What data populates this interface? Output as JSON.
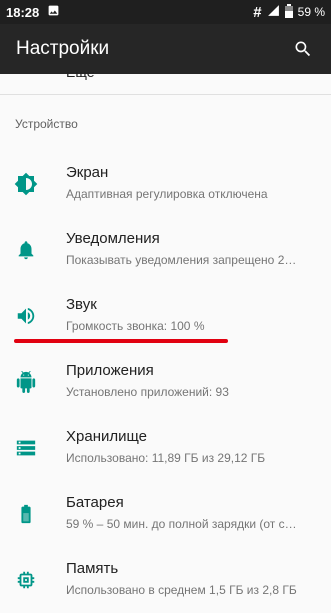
{
  "status_bar": {
    "time": "18:28",
    "image_icon": "image-icon",
    "hash_icon": "hash-icon",
    "battery_percent": "59 %"
  },
  "app_bar": {
    "title": "Настройки",
    "search_icon": "search-icon"
  },
  "partial_item": {
    "title": "Еще"
  },
  "section": {
    "header": "Устройство"
  },
  "items": [
    {
      "title": "Экран",
      "summary": "Адаптивная регулировка отключена",
      "icon": "brightness-icon"
    },
    {
      "title": "Уведомления",
      "summary": "Показывать уведомления запрещено 2…",
      "icon": "bell-icon"
    },
    {
      "title": "Звук",
      "summary": "Громкость звонка: 100 %",
      "icon": "volume-icon"
    },
    {
      "title": "Приложения",
      "summary": "Установлено приложений: 93",
      "icon": "android-icon"
    },
    {
      "title": "Хранилище",
      "summary": "Использовано: 11,89 ГБ из 29,12 ГБ",
      "icon": "storage-icon"
    },
    {
      "title": "Батарея",
      "summary": "59 % – 50 мин. до полной зарядки (от с…",
      "icon": "battery-icon"
    },
    {
      "title": "Память",
      "summary": "Использовано в среднем 1,5 ГБ из 2,8 ГБ",
      "icon": "memory-icon"
    }
  ],
  "colors": {
    "accent": "#009688",
    "annotation": "#e10010"
  }
}
